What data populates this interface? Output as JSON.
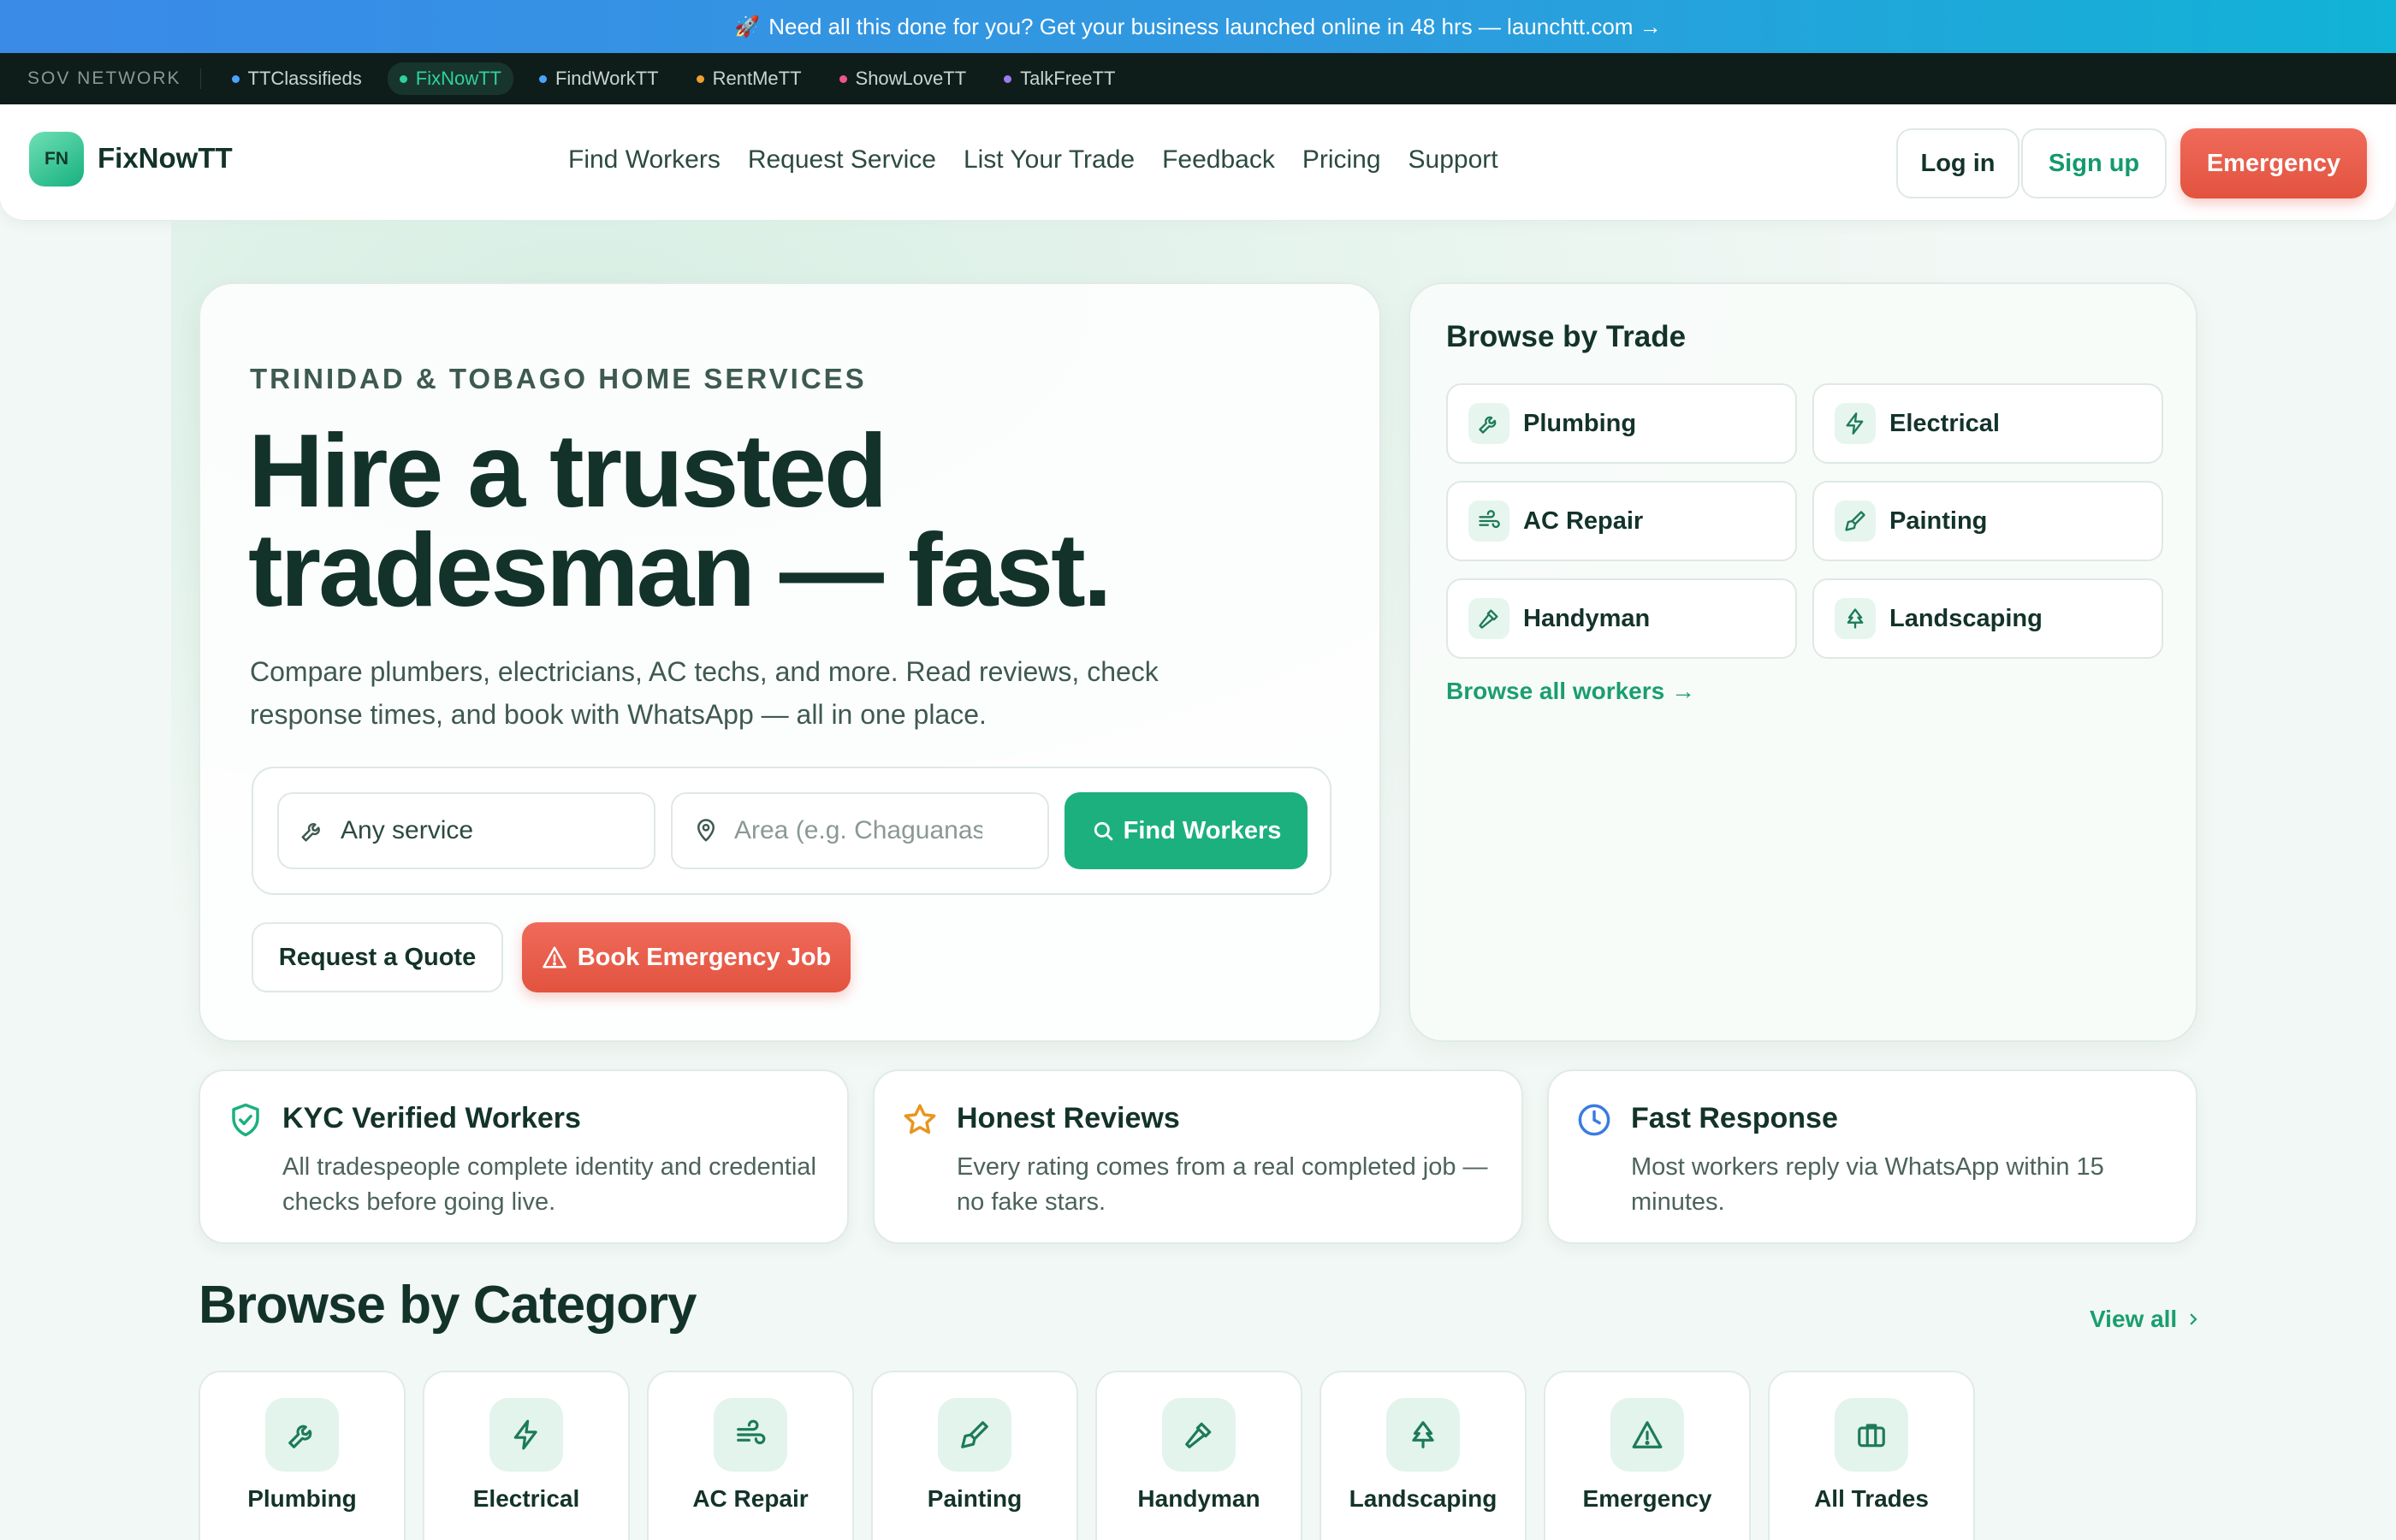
{
  "promo": {
    "rocket": "🚀",
    "text": "Need all this done for you? Get your business launched online in 48 hrs — launchtt.com →"
  },
  "network": {
    "label": "SOV NETWORK",
    "items": [
      {
        "name": "TTClassifieds",
        "color": "#4aa3ff"
      },
      {
        "name": "FixNowTT",
        "color": "#2fd19a",
        "active": true
      },
      {
        "name": "FindWorkTT",
        "color": "#4aa3ff"
      },
      {
        "name": "RentMeTT",
        "color": "#f0a030"
      },
      {
        "name": "ShowLoveTT",
        "color": "#f0558a"
      },
      {
        "name": "TalkFreeTT",
        "color": "#9a7cf0"
      }
    ]
  },
  "nav": {
    "logo_badge": "FN",
    "logo_text": "FixNowTT",
    "links": [
      "Find Workers",
      "Request Service",
      "List Your Trade",
      "Feedback",
      "Pricing",
      "Support"
    ],
    "login": "Log in",
    "signup": "Sign up",
    "emergency": "Emergency"
  },
  "hero": {
    "eyebrow": "TRINIDAD & TOBAGO HOME SERVICES",
    "headline_line1": "Hire a trusted",
    "headline_line2": "tradesman — fast.",
    "subtext": "Compare plumbers, electricians, AC techs, and more. Read reviews, check response times, and book with WhatsApp — all in one place.",
    "service_value": "Any service",
    "area_placeholder": "Area (e.g. Chaguanas)",
    "find_button": "Find Workers",
    "request_quote": "Request a Quote",
    "book_emergency": "Book Emergency Job"
  },
  "trades": {
    "title": "Browse by Trade",
    "items": [
      {
        "label": "Plumbing",
        "icon": "wrench-icon"
      },
      {
        "label": "Electrical",
        "icon": "bolt-icon"
      },
      {
        "label": "AC Repair",
        "icon": "wind-icon"
      },
      {
        "label": "Painting",
        "icon": "brush-icon"
      },
      {
        "label": "Handyman",
        "icon": "hammer-icon"
      },
      {
        "label": "Landscaping",
        "icon": "tree-icon"
      }
    ],
    "browse_all": "Browse all workers →"
  },
  "features": [
    {
      "title": "KYC Verified Workers",
      "desc": "All tradespeople complete identity and credential checks before going live.",
      "icon": "shield-check-icon",
      "color": "#1cb07e"
    },
    {
      "title": "Honest Reviews",
      "desc": "Every rating comes from a real completed job — no fake stars.",
      "icon": "star-icon",
      "color": "#e8961e"
    },
    {
      "title": "Fast Response",
      "desc": "Most workers reply via WhatsApp within 15 minutes.",
      "icon": "clock-icon",
      "color": "#3a7be0"
    }
  ],
  "categories": {
    "heading": "Browse by Category",
    "view_all": "View all",
    "items": [
      {
        "label": "Plumbing",
        "icon": "wrench-icon"
      },
      {
        "label": "Electrical",
        "icon": "bolt-icon"
      },
      {
        "label": "AC Repair",
        "icon": "wind-icon"
      },
      {
        "label": "Painting",
        "icon": "brush-icon"
      },
      {
        "label": "Handyman",
        "icon": "hammer-icon"
      },
      {
        "label": "Landscaping",
        "icon": "tree-icon"
      },
      {
        "label": "Emergency",
        "icon": "warning-icon"
      },
      {
        "label": "All Trades",
        "icon": "briefcase-icon"
      }
    ]
  },
  "colors": {
    "brand": "#1cb07e",
    "emergency": "#e2533f",
    "text": "#13332a"
  }
}
